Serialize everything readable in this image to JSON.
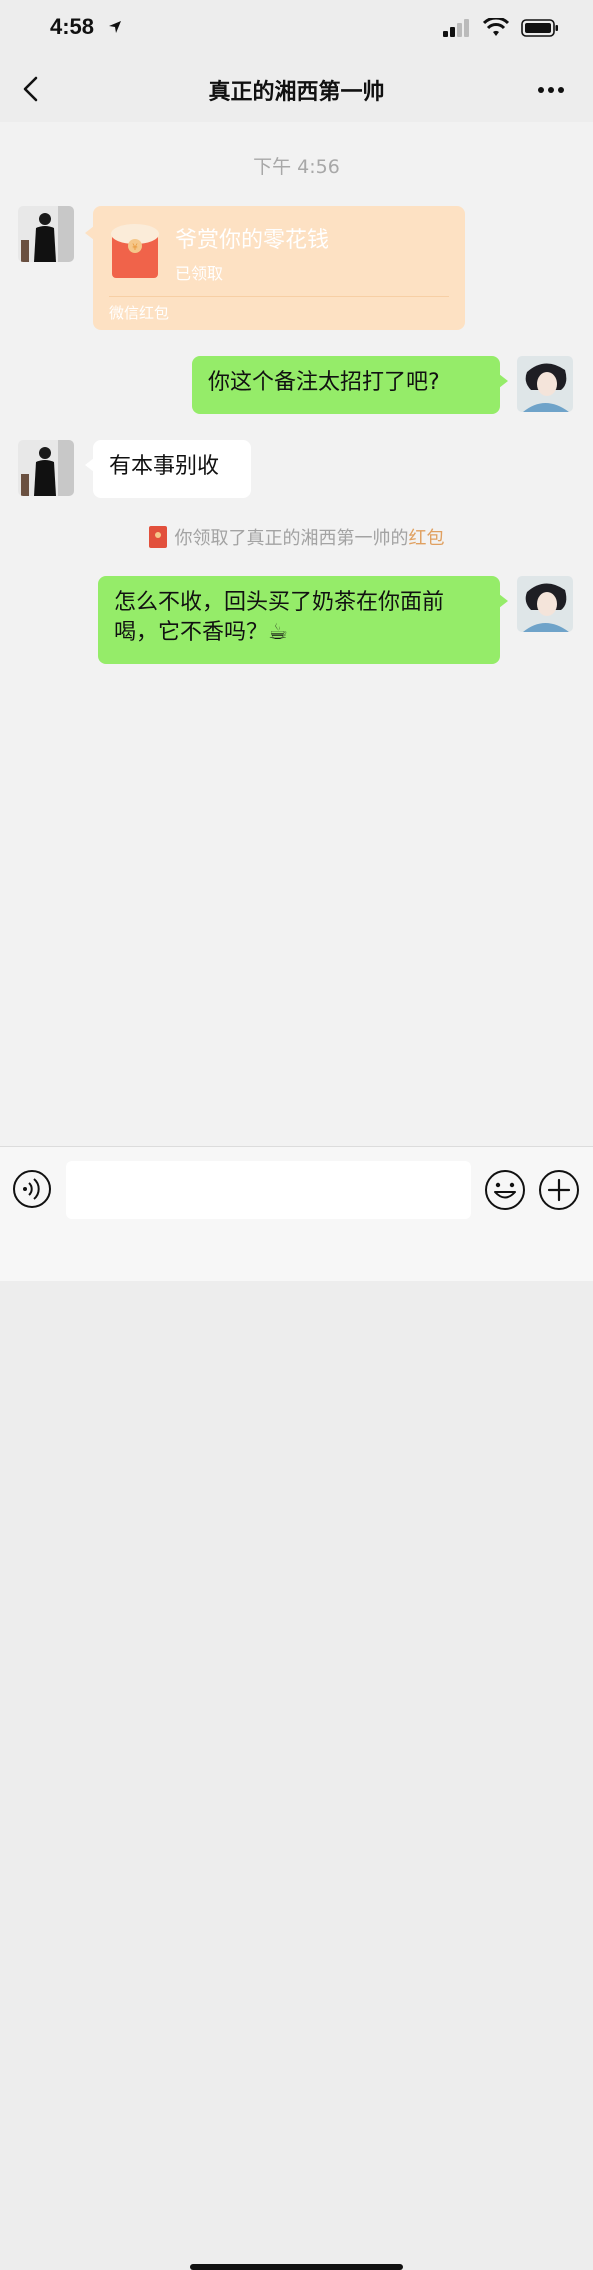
{
  "status_bar": {
    "time": "4:58"
  },
  "header": {
    "title": "真正的湘西第一帅"
  },
  "chat": {
    "timestamp": "下午 4:56",
    "red_packet": {
      "title": "爷赏你的零花钱",
      "status": "已领取",
      "footer": "微信红包"
    },
    "messages": [
      {
        "side": "right",
        "text": "你这个备注太招打了吧?"
      },
      {
        "side": "left",
        "text": "有本事别收"
      },
      {
        "side": "right",
        "text": "怎么不收，回头买了奶茶在你面前喝，它不香吗？☕"
      }
    ],
    "system_note": {
      "prefix": "你领取了真正的湘西第一帅的",
      "link": "红包"
    }
  },
  "input": {
    "placeholder": ""
  },
  "colors": {
    "bubble_green": "#95ec69",
    "red_packet_bg": "#fde1c3",
    "link_orange": "#e0a060"
  }
}
